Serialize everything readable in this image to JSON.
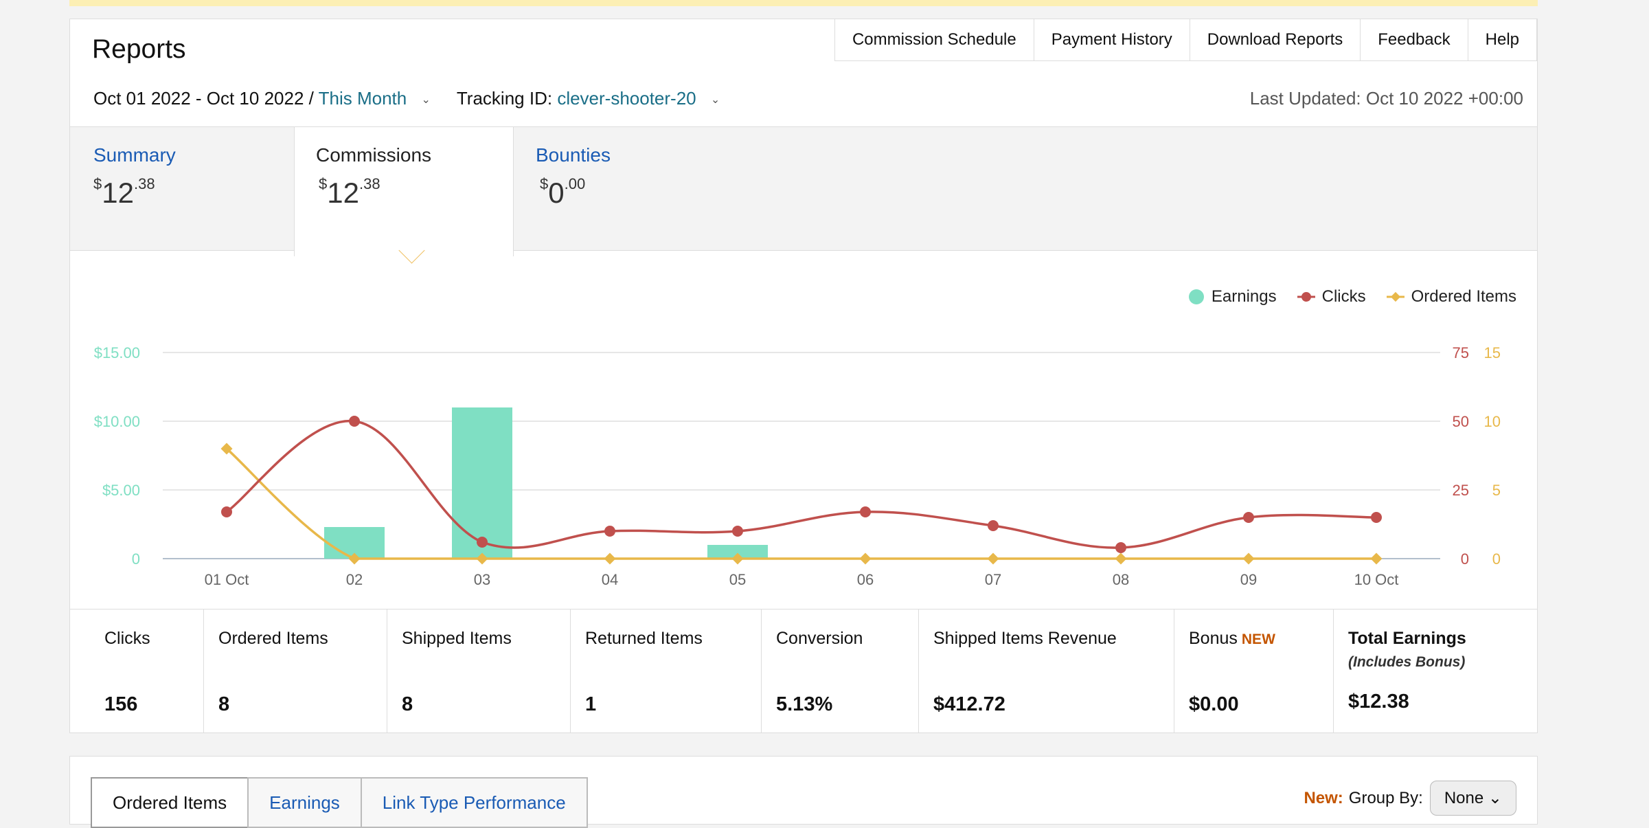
{
  "header": {
    "title": "Reports",
    "links": [
      "Commission Schedule",
      "Payment History",
      "Download Reports",
      "Feedback",
      "Help"
    ]
  },
  "filters": {
    "date_range": "Oct 01 2022 - Oct 10 2022 /",
    "period": "This Month",
    "tracking_label": "Tracking ID:",
    "tracking_id": "clever-shooter-20",
    "last_updated": "Last Updated: Oct 10 2022 +00:00"
  },
  "tabs": [
    {
      "label": "Summary",
      "dollar": "$",
      "whole": "12",
      "cents": ".38",
      "active": false
    },
    {
      "label": "Commissions",
      "dollar": "$",
      "whole": "12",
      "cents": ".38",
      "active": true
    },
    {
      "label": "Bounties",
      "dollar": "$",
      "whole": "0",
      "cents": ".00",
      "active": false
    }
  ],
  "legend": {
    "earnings": "Earnings",
    "clicks": "Clicks",
    "ordered": "Ordered Items"
  },
  "colors": {
    "earnings": "#7fdfc3",
    "clicks": "#c0504d",
    "ordered": "#e8b84a",
    "link": "#1a5bb4",
    "new": "#c45500"
  },
  "chart_data": {
    "type": "bar",
    "categories": [
      "01 Oct",
      "02",
      "03",
      "04",
      "05",
      "06",
      "07",
      "08",
      "09",
      "10 Oct"
    ],
    "series": [
      {
        "name": "Earnings",
        "type": "bar",
        "axis": "left",
        "values": [
          0,
          2.3,
          11.0,
          0,
          1.0,
          0,
          0,
          0,
          0,
          0
        ]
      },
      {
        "name": "Clicks",
        "type": "line",
        "axis": "right",
        "values": [
          17,
          50,
          6,
          10,
          10,
          17,
          12,
          4,
          15,
          15
        ]
      },
      {
        "name": "Ordered Items",
        "type": "line",
        "axis": "right2",
        "values": [
          8,
          0,
          0,
          0,
          0,
          0,
          0,
          0,
          0,
          0
        ]
      }
    ],
    "left_axis": {
      "ticks": [
        "0",
        "$5.00",
        "$10.00",
        "$15.00"
      ],
      "ylim": [
        0,
        15
      ]
    },
    "right_axis": {
      "ticks": [
        "0",
        "25",
        "50",
        "75"
      ],
      "ylim": [
        0,
        75
      ]
    },
    "right2_axis": {
      "ticks": [
        "0",
        "5",
        "10",
        "15"
      ],
      "ylim": [
        0,
        15
      ]
    },
    "grid": true,
    "legend_position": "top-right"
  },
  "stats": [
    {
      "label": "Clicks",
      "value": "156"
    },
    {
      "label": "Ordered Items",
      "value": "8"
    },
    {
      "label": "Shipped Items",
      "value": "8"
    },
    {
      "label": "Returned Items",
      "value": "1"
    },
    {
      "label": "Conversion",
      "value": "5.13%"
    },
    {
      "label": "Shipped Items Revenue",
      "value": "$412.72"
    },
    {
      "label": "Bonus",
      "badge": "NEW",
      "value": "$0.00"
    },
    {
      "label": "Total Earnings",
      "sublabel": "(Includes Bonus)",
      "value": "$12.38"
    }
  ],
  "bottom": {
    "tabs": [
      "Ordered Items",
      "Earnings",
      "Link Type Performance"
    ],
    "new_label": "New:",
    "group_by_label": "Group By:",
    "group_by_value": "None"
  }
}
